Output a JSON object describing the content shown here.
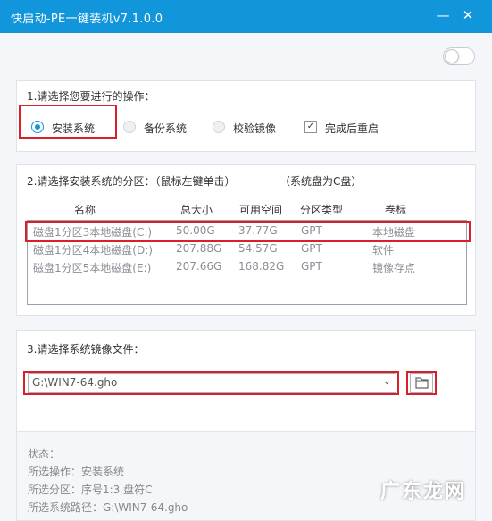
{
  "window": {
    "title": "快启动-PE一键装机v7.1.0.0",
    "minimize_glyph": "—",
    "close_glyph": "✕"
  },
  "toggle": {
    "state": "off"
  },
  "operation": {
    "title": "1.请选择您要进行的操作：",
    "options": [
      {
        "label": "安装系统",
        "selected": true
      },
      {
        "label": "备份系统",
        "selected": false
      },
      {
        "label": "校验镜像",
        "selected": false
      }
    ],
    "reboot_checkbox": {
      "label": "完成后重启",
      "checked": true
    }
  },
  "partition": {
    "title": "2.请选择安装系统的分区：（鼠标左键单击）",
    "note": "（系统盘为C盘）",
    "columns": [
      "名称",
      "总大小",
      "可用空间",
      "分区类型",
      "卷标"
    ],
    "rows": [
      [
        "磁盘1分区3本地磁盘(C:)",
        "50.00G",
        "37.77G",
        "GPT",
        "本地磁盘"
      ],
      [
        "磁盘1分区4本地磁盘(D:)",
        "207.88G",
        "54.57G",
        "GPT",
        "软件"
      ],
      [
        "磁盘1分区5本地磁盘(E:)",
        "207.66G",
        "168.82G",
        "GPT",
        "镜像存点"
      ]
    ]
  },
  "image": {
    "title": "3.请选择系统镜像文件：",
    "selected_file": "G:\\WIN7-64.gho",
    "dropdown_icon": "chevron-down",
    "browse_icon": "folder"
  },
  "status": {
    "label": "状态：",
    "operation": "所选操作：安装系统",
    "partition": "所选分区：序号1:3    盘符C",
    "image_path": "所选系统路径：G:\\WIN7-64.gho"
  },
  "watermark": "广东龙网",
  "colors": {
    "titlebar": "#1296db",
    "highlight": "#d9202a",
    "radio_selected": "#1296db"
  }
}
